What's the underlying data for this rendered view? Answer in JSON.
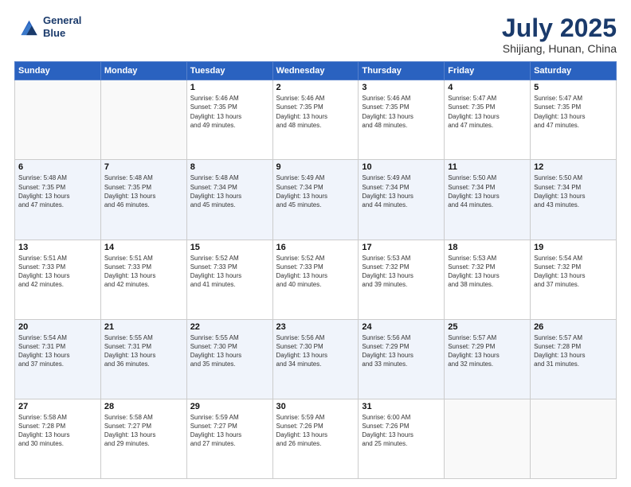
{
  "logo": {
    "line1": "General",
    "line2": "Blue"
  },
  "title": "July 2025",
  "location": "Shijiang, Hunan, China",
  "days_of_week": [
    "Sunday",
    "Monday",
    "Tuesday",
    "Wednesday",
    "Thursday",
    "Friday",
    "Saturday"
  ],
  "weeks": [
    [
      {
        "day": "",
        "info": ""
      },
      {
        "day": "",
        "info": ""
      },
      {
        "day": "1",
        "info": "Sunrise: 5:46 AM\nSunset: 7:35 PM\nDaylight: 13 hours\nand 49 minutes."
      },
      {
        "day": "2",
        "info": "Sunrise: 5:46 AM\nSunset: 7:35 PM\nDaylight: 13 hours\nand 48 minutes."
      },
      {
        "day": "3",
        "info": "Sunrise: 5:46 AM\nSunset: 7:35 PM\nDaylight: 13 hours\nand 48 minutes."
      },
      {
        "day": "4",
        "info": "Sunrise: 5:47 AM\nSunset: 7:35 PM\nDaylight: 13 hours\nand 47 minutes."
      },
      {
        "day": "5",
        "info": "Sunrise: 5:47 AM\nSunset: 7:35 PM\nDaylight: 13 hours\nand 47 minutes."
      }
    ],
    [
      {
        "day": "6",
        "info": "Sunrise: 5:48 AM\nSunset: 7:35 PM\nDaylight: 13 hours\nand 47 minutes."
      },
      {
        "day": "7",
        "info": "Sunrise: 5:48 AM\nSunset: 7:35 PM\nDaylight: 13 hours\nand 46 minutes."
      },
      {
        "day": "8",
        "info": "Sunrise: 5:48 AM\nSunset: 7:34 PM\nDaylight: 13 hours\nand 45 minutes."
      },
      {
        "day": "9",
        "info": "Sunrise: 5:49 AM\nSunset: 7:34 PM\nDaylight: 13 hours\nand 45 minutes."
      },
      {
        "day": "10",
        "info": "Sunrise: 5:49 AM\nSunset: 7:34 PM\nDaylight: 13 hours\nand 44 minutes."
      },
      {
        "day": "11",
        "info": "Sunrise: 5:50 AM\nSunset: 7:34 PM\nDaylight: 13 hours\nand 44 minutes."
      },
      {
        "day": "12",
        "info": "Sunrise: 5:50 AM\nSunset: 7:34 PM\nDaylight: 13 hours\nand 43 minutes."
      }
    ],
    [
      {
        "day": "13",
        "info": "Sunrise: 5:51 AM\nSunset: 7:33 PM\nDaylight: 13 hours\nand 42 minutes."
      },
      {
        "day": "14",
        "info": "Sunrise: 5:51 AM\nSunset: 7:33 PM\nDaylight: 13 hours\nand 42 minutes."
      },
      {
        "day": "15",
        "info": "Sunrise: 5:52 AM\nSunset: 7:33 PM\nDaylight: 13 hours\nand 41 minutes."
      },
      {
        "day": "16",
        "info": "Sunrise: 5:52 AM\nSunset: 7:33 PM\nDaylight: 13 hours\nand 40 minutes."
      },
      {
        "day": "17",
        "info": "Sunrise: 5:53 AM\nSunset: 7:32 PM\nDaylight: 13 hours\nand 39 minutes."
      },
      {
        "day": "18",
        "info": "Sunrise: 5:53 AM\nSunset: 7:32 PM\nDaylight: 13 hours\nand 38 minutes."
      },
      {
        "day": "19",
        "info": "Sunrise: 5:54 AM\nSunset: 7:32 PM\nDaylight: 13 hours\nand 37 minutes."
      }
    ],
    [
      {
        "day": "20",
        "info": "Sunrise: 5:54 AM\nSunset: 7:31 PM\nDaylight: 13 hours\nand 37 minutes."
      },
      {
        "day": "21",
        "info": "Sunrise: 5:55 AM\nSunset: 7:31 PM\nDaylight: 13 hours\nand 36 minutes."
      },
      {
        "day": "22",
        "info": "Sunrise: 5:55 AM\nSunset: 7:30 PM\nDaylight: 13 hours\nand 35 minutes."
      },
      {
        "day": "23",
        "info": "Sunrise: 5:56 AM\nSunset: 7:30 PM\nDaylight: 13 hours\nand 34 minutes."
      },
      {
        "day": "24",
        "info": "Sunrise: 5:56 AM\nSunset: 7:29 PM\nDaylight: 13 hours\nand 33 minutes."
      },
      {
        "day": "25",
        "info": "Sunrise: 5:57 AM\nSunset: 7:29 PM\nDaylight: 13 hours\nand 32 minutes."
      },
      {
        "day": "26",
        "info": "Sunrise: 5:57 AM\nSunset: 7:28 PM\nDaylight: 13 hours\nand 31 minutes."
      }
    ],
    [
      {
        "day": "27",
        "info": "Sunrise: 5:58 AM\nSunset: 7:28 PM\nDaylight: 13 hours\nand 30 minutes."
      },
      {
        "day": "28",
        "info": "Sunrise: 5:58 AM\nSunset: 7:27 PM\nDaylight: 13 hours\nand 29 minutes."
      },
      {
        "day": "29",
        "info": "Sunrise: 5:59 AM\nSunset: 7:27 PM\nDaylight: 13 hours\nand 27 minutes."
      },
      {
        "day": "30",
        "info": "Sunrise: 5:59 AM\nSunset: 7:26 PM\nDaylight: 13 hours\nand 26 minutes."
      },
      {
        "day": "31",
        "info": "Sunrise: 6:00 AM\nSunset: 7:26 PM\nDaylight: 13 hours\nand 25 minutes."
      },
      {
        "day": "",
        "info": ""
      },
      {
        "day": "",
        "info": ""
      }
    ]
  ]
}
